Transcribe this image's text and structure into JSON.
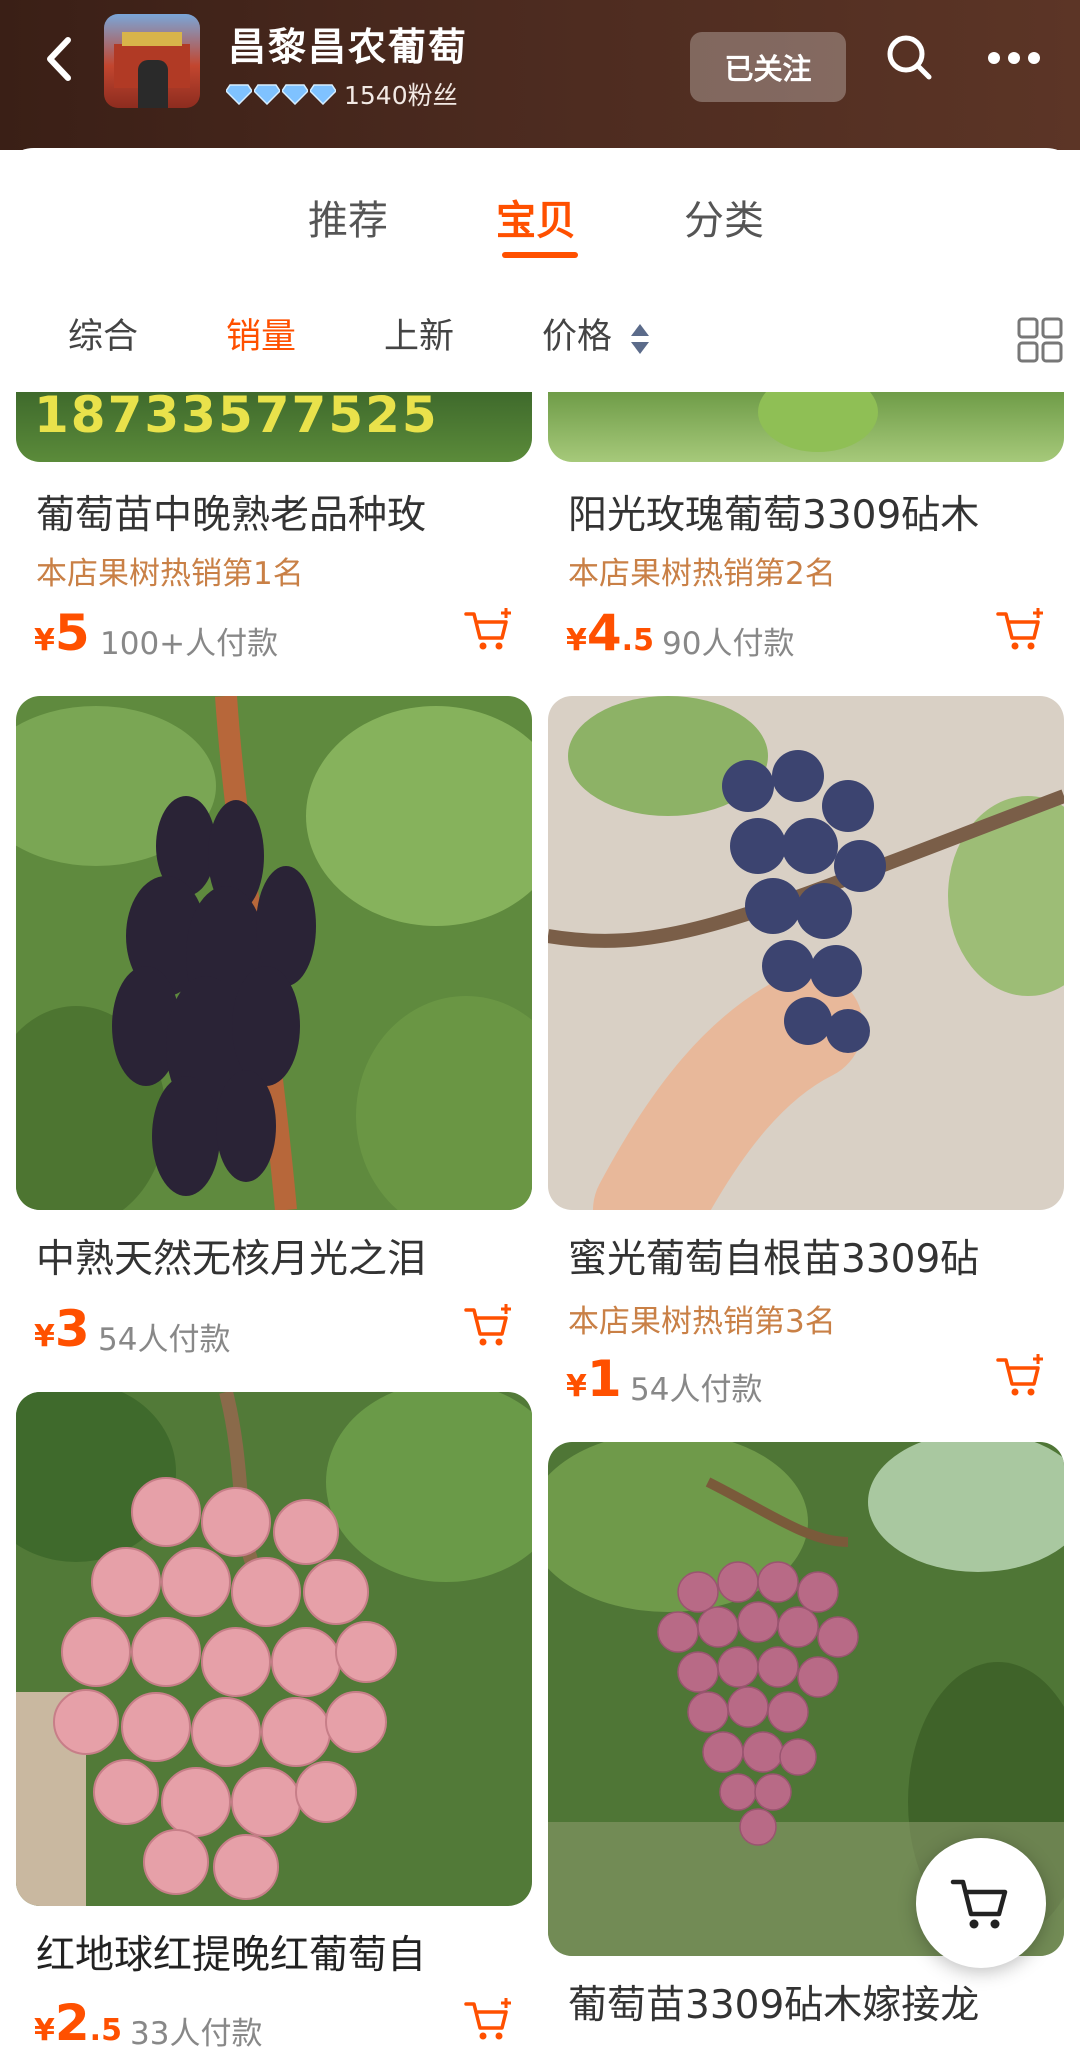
{
  "header": {
    "shop_name": "昌黎昌农葡萄",
    "fans": "1540粉丝",
    "follow_label": "已关注"
  },
  "tabs": [
    {
      "label": "推荐"
    },
    {
      "label": "宝贝"
    },
    {
      "label": "分类"
    }
  ],
  "sort": [
    {
      "label": "综合"
    },
    {
      "label": "销量"
    },
    {
      "label": "上新"
    },
    {
      "label": "价格"
    }
  ],
  "products": [
    {
      "title": "葡萄苗中晚熟老品种玫",
      "rank": "本店果树热销第1名",
      "price_int": "5",
      "price_dec": "",
      "sales": "100+人付款",
      "image_text": "18733577525"
    },
    {
      "title": "阳光玫瑰葡萄3309砧木",
      "rank": "本店果树热销第2名",
      "price_int": "4",
      "price_dec": ".5",
      "sales": "90人付款"
    },
    {
      "title": "中熟天然无核月光之泪",
      "rank": "",
      "price_int": "3",
      "price_dec": "",
      "sales": "54人付款"
    },
    {
      "title": "蜜光葡萄自根苗3309砧",
      "rank": "本店果树热销第3名",
      "price_int": "1",
      "price_dec": "",
      "sales": "54人付款"
    },
    {
      "title": "红地球红提晚红葡萄自",
      "rank": "",
      "price_int": "2",
      "price_dec": ".5",
      "sales": "33人付款"
    },
    {
      "title": "葡萄苗3309砧木嫁接龙",
      "rank": "",
      "price_int": "",
      "price_dec": "",
      "sales": ""
    }
  ],
  "currency_symbol": "¥",
  "colors": {
    "accent": "#ff5000",
    "rank": "#c98046",
    "header_bg": "#4b2a1f"
  }
}
